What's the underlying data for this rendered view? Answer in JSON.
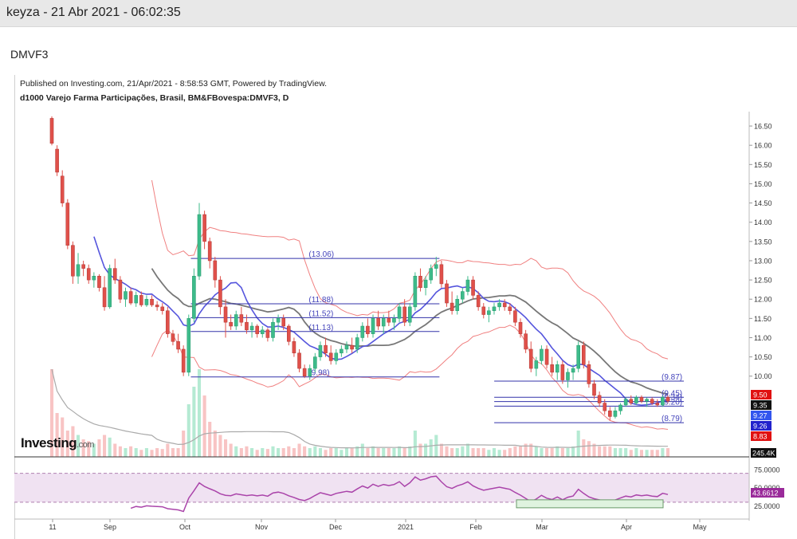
{
  "post": {
    "title": "keyza - 21 Abr 2021 - 06:02:35",
    "subject": "DMVF3"
  },
  "chart_header": {
    "published": "Published on Investing.com, 21/Apr/2021 - 8:58:53 GMT, Powered by TradingView.",
    "instrument": "d1000 Varejo Farma Participações, Brasil, BM&FBovespa:DMVF3, D"
  },
  "logo": {
    "text": "Investing",
    "suffix": ".com"
  },
  "colors": {
    "up": "#3dbb8a",
    "down": "#e0504a",
    "level_line": "#3333aa",
    "ma_fast": "#5555dd",
    "ma_slow": "#777777",
    "band": "#f08080",
    "rsi": "#aa44aa",
    "rsi_fill": "#f0e2f2"
  },
  "chart_data": {
    "type": "candlestick",
    "title": "",
    "x_ticks": [
      "11",
      "Sep",
      "Oct",
      "Nov",
      "Dec",
      "2021",
      "Feb",
      "Mar",
      "Apr",
      "May"
    ],
    "price_axis": {
      "ylim": [
        9.0,
        16.75
      ],
      "ticks": [
        "16.50",
        "16.00",
        "15.50",
        "15.00",
        "14.50",
        "14.00",
        "13.50",
        "13.00",
        "12.50",
        "12.00",
        "11.50",
        "11.00",
        "10.50",
        "10.00"
      ]
    },
    "price_levels": [
      {
        "label": "(13.06)",
        "value": 13.06
      },
      {
        "label": "(11.88)",
        "value": 11.88
      },
      {
        "label": "(11.52)",
        "value": 11.52
      },
      {
        "label": "(11.13)",
        "value": 11.16
      },
      {
        "label": "(9.98)",
        "value": 9.98
      },
      {
        "label": "(9.87)",
        "value": 9.87
      },
      {
        "label": "(9.45)",
        "value": 9.45
      },
      {
        "label": "(9.34)",
        "value": 9.34
      },
      {
        "label": "(9.20)",
        "value": 9.22
      },
      {
        "label": "(8.79)",
        "value": 8.79
      }
    ],
    "price_badges": [
      {
        "label": "9.50",
        "value": 9.5,
        "color": "#e01010"
      },
      {
        "label": "9.35",
        "value": 9.35,
        "color": "#111111"
      },
      {
        "label": "9.27",
        "value": 9.27,
        "color": "#3355ee"
      },
      {
        "label": "9.26",
        "value": 9.26,
        "color": "#2222cc"
      },
      {
        "label": "8.83",
        "value": 8.83,
        "color": "#e01010"
      }
    ],
    "volume_badge": {
      "label": "245.4K"
    },
    "rsi": {
      "ticks": [
        "75.0000",
        "50.0000",
        "25.0000"
      ],
      "current_label": "43.6612",
      "ylim": [
        10,
        85
      ]
    },
    "candles": [
      {
        "o": 16.7,
        "h": 16.75,
        "l": 16.0,
        "c": 16.05
      },
      {
        "o": 15.9,
        "h": 16.0,
        "l": 15.2,
        "c": 15.3
      },
      {
        "o": 15.2,
        "h": 15.35,
        "l": 14.4,
        "c": 14.5
      },
      {
        "o": 14.5,
        "h": 14.6,
        "l": 13.3,
        "c": 13.4
      },
      {
        "o": 13.4,
        "h": 13.5,
        "l": 12.4,
        "c": 12.6
      },
      {
        "o": 12.6,
        "h": 13.2,
        "l": 12.4,
        "c": 12.9
      },
      {
        "o": 12.9,
        "h": 13.0,
        "l": 12.6,
        "c": 12.8
      },
      {
        "o": 12.8,
        "h": 12.9,
        "l": 12.4,
        "c": 12.5
      },
      {
        "o": 12.5,
        "h": 12.7,
        "l": 12.3,
        "c": 12.6
      },
      {
        "o": 12.6,
        "h": 12.65,
        "l": 12.2,
        "c": 12.3
      },
      {
        "o": 12.3,
        "h": 12.6,
        "l": 11.7,
        "c": 11.8
      },
      {
        "o": 11.8,
        "h": 12.9,
        "l": 11.75,
        "c": 12.8
      },
      {
        "o": 12.8,
        "h": 13.05,
        "l": 12.4,
        "c": 12.5
      },
      {
        "o": 12.5,
        "h": 12.6,
        "l": 11.9,
        "c": 12.0
      },
      {
        "o": 12.0,
        "h": 12.3,
        "l": 11.8,
        "c": 12.2
      },
      {
        "o": 12.2,
        "h": 12.3,
        "l": 11.85,
        "c": 11.9
      },
      {
        "o": 11.9,
        "h": 12.2,
        "l": 11.8,
        "c": 12.1
      },
      {
        "o": 12.1,
        "h": 12.2,
        "l": 11.8,
        "c": 11.85
      },
      {
        "o": 11.85,
        "h": 12.1,
        "l": 11.8,
        "c": 12.0
      },
      {
        "o": 12.0,
        "h": 12.1,
        "l": 11.8,
        "c": 11.85
      },
      {
        "o": 11.85,
        "h": 11.95,
        "l": 11.7,
        "c": 11.8
      },
      {
        "o": 11.8,
        "h": 11.9,
        "l": 11.6,
        "c": 11.7
      },
      {
        "o": 11.7,
        "h": 11.8,
        "l": 11.0,
        "c": 11.1
      },
      {
        "o": 11.1,
        "h": 11.2,
        "l": 10.8,
        "c": 10.9
      },
      {
        "o": 10.9,
        "h": 11.1,
        "l": 10.6,
        "c": 10.7
      },
      {
        "o": 10.7,
        "h": 10.8,
        "l": 10.0,
        "c": 10.1
      },
      {
        "o": 10.1,
        "h": 11.6,
        "l": 10.0,
        "c": 11.5
      },
      {
        "o": 11.5,
        "h": 12.8,
        "l": 11.4,
        "c": 12.6
      },
      {
        "o": 12.6,
        "h": 14.5,
        "l": 12.5,
        "c": 14.2
      },
      {
        "o": 14.2,
        "h": 14.3,
        "l": 13.3,
        "c": 13.5
      },
      {
        "o": 13.5,
        "h": 13.6,
        "l": 12.8,
        "c": 13.0
      },
      {
        "o": 13.0,
        "h": 13.1,
        "l": 12.3,
        "c": 12.5
      },
      {
        "o": 12.5,
        "h": 12.6,
        "l": 11.6,
        "c": 11.8
      },
      {
        "o": 11.8,
        "h": 12.0,
        "l": 11.0,
        "c": 11.4
      },
      {
        "o": 11.4,
        "h": 11.6,
        "l": 11.2,
        "c": 11.3
      },
      {
        "o": 11.3,
        "h": 11.7,
        "l": 11.2,
        "c": 11.6
      },
      {
        "o": 11.6,
        "h": 11.8,
        "l": 11.3,
        "c": 11.4
      },
      {
        "o": 11.4,
        "h": 11.6,
        "l": 11.1,
        "c": 11.2
      },
      {
        "o": 11.2,
        "h": 11.4,
        "l": 11.0,
        "c": 11.3
      },
      {
        "o": 11.3,
        "h": 11.35,
        "l": 11.0,
        "c": 11.1
      },
      {
        "o": 11.1,
        "h": 11.3,
        "l": 11.0,
        "c": 11.2
      },
      {
        "o": 11.2,
        "h": 11.25,
        "l": 10.9,
        "c": 11.0
      },
      {
        "o": 11.0,
        "h": 11.5,
        "l": 10.9,
        "c": 11.4
      },
      {
        "o": 11.4,
        "h": 11.6,
        "l": 11.2,
        "c": 11.5
      },
      {
        "o": 11.5,
        "h": 11.6,
        "l": 11.2,
        "c": 11.3
      },
      {
        "o": 11.3,
        "h": 11.35,
        "l": 10.8,
        "c": 10.9
      },
      {
        "o": 10.9,
        "h": 11.0,
        "l": 10.5,
        "c": 10.6
      },
      {
        "o": 10.6,
        "h": 10.7,
        "l": 10.1,
        "c": 10.2
      },
      {
        "o": 10.2,
        "h": 10.3,
        "l": 9.95,
        "c": 10.0
      },
      {
        "o": 10.0,
        "h": 10.3,
        "l": 9.9,
        "c": 10.2
      },
      {
        "o": 10.2,
        "h": 10.6,
        "l": 10.1,
        "c": 10.5
      },
      {
        "o": 10.5,
        "h": 10.9,
        "l": 10.4,
        "c": 10.8
      },
      {
        "o": 10.8,
        "h": 11.0,
        "l": 10.5,
        "c": 10.6
      },
      {
        "o": 10.6,
        "h": 10.8,
        "l": 10.3,
        "c": 10.4
      },
      {
        "o": 10.4,
        "h": 10.7,
        "l": 10.3,
        "c": 10.6
      },
      {
        "o": 10.6,
        "h": 10.8,
        "l": 10.5,
        "c": 10.7
      },
      {
        "o": 10.7,
        "h": 10.9,
        "l": 10.6,
        "c": 10.8
      },
      {
        "o": 10.8,
        "h": 11.0,
        "l": 10.6,
        "c": 10.7
      },
      {
        "o": 10.7,
        "h": 11.1,
        "l": 10.6,
        "c": 11.0
      },
      {
        "o": 11.0,
        "h": 11.4,
        "l": 10.9,
        "c": 11.3
      },
      {
        "o": 11.3,
        "h": 11.5,
        "l": 11.0,
        "c": 11.1
      },
      {
        "o": 11.1,
        "h": 11.6,
        "l": 11.0,
        "c": 11.5
      },
      {
        "o": 11.5,
        "h": 11.7,
        "l": 11.2,
        "c": 11.3
      },
      {
        "o": 11.3,
        "h": 11.6,
        "l": 11.1,
        "c": 11.5
      },
      {
        "o": 11.5,
        "h": 11.7,
        "l": 11.3,
        "c": 11.4
      },
      {
        "o": 11.4,
        "h": 11.6,
        "l": 11.2,
        "c": 11.5
      },
      {
        "o": 11.5,
        "h": 11.9,
        "l": 11.4,
        "c": 11.8
      },
      {
        "o": 11.8,
        "h": 12.0,
        "l": 11.3,
        "c": 11.4
      },
      {
        "o": 11.4,
        "h": 11.9,
        "l": 11.3,
        "c": 11.8
      },
      {
        "o": 11.8,
        "h": 12.7,
        "l": 11.7,
        "c": 12.6
      },
      {
        "o": 12.6,
        "h": 12.8,
        "l": 12.2,
        "c": 12.3
      },
      {
        "o": 12.3,
        "h": 12.6,
        "l": 12.1,
        "c": 12.5
      },
      {
        "o": 12.5,
        "h": 12.9,
        "l": 12.4,
        "c": 12.8
      },
      {
        "o": 12.8,
        "h": 13.1,
        "l": 12.6,
        "c": 12.9
      },
      {
        "o": 12.9,
        "h": 13.0,
        "l": 12.3,
        "c": 12.4
      },
      {
        "o": 12.4,
        "h": 12.5,
        "l": 11.8,
        "c": 11.9
      },
      {
        "o": 11.9,
        "h": 12.2,
        "l": 11.6,
        "c": 11.7
      },
      {
        "o": 11.7,
        "h": 12.1,
        "l": 11.6,
        "c": 12.0
      },
      {
        "o": 12.0,
        "h": 12.3,
        "l": 11.9,
        "c": 12.2
      },
      {
        "o": 12.2,
        "h": 12.6,
        "l": 12.1,
        "c": 12.5
      },
      {
        "o": 12.5,
        "h": 12.6,
        "l": 12.0,
        "c": 12.1
      },
      {
        "o": 12.1,
        "h": 12.2,
        "l": 11.7,
        "c": 11.8
      },
      {
        "o": 11.8,
        "h": 11.9,
        "l": 11.5,
        "c": 11.6
      },
      {
        "o": 11.6,
        "h": 11.8,
        "l": 11.4,
        "c": 11.7
      },
      {
        "o": 11.7,
        "h": 11.9,
        "l": 11.6,
        "c": 11.8
      },
      {
        "o": 11.8,
        "h": 12.0,
        "l": 11.7,
        "c": 11.9
      },
      {
        "o": 11.9,
        "h": 12.0,
        "l": 11.7,
        "c": 11.8
      },
      {
        "o": 11.8,
        "h": 11.9,
        "l": 11.6,
        "c": 11.7
      },
      {
        "o": 11.7,
        "h": 11.8,
        "l": 11.3,
        "c": 11.4
      },
      {
        "o": 11.4,
        "h": 11.5,
        "l": 11.0,
        "c": 11.1
      },
      {
        "o": 11.1,
        "h": 11.2,
        "l": 10.6,
        "c": 10.7
      },
      {
        "o": 10.7,
        "h": 10.9,
        "l": 10.1,
        "c": 10.2
      },
      {
        "o": 10.2,
        "h": 10.5,
        "l": 10.0,
        "c": 10.4
      },
      {
        "o": 10.4,
        "h": 10.8,
        "l": 10.3,
        "c": 10.7
      },
      {
        "o": 10.7,
        "h": 10.8,
        "l": 10.2,
        "c": 10.3
      },
      {
        "o": 10.3,
        "h": 10.5,
        "l": 10.0,
        "c": 10.1
      },
      {
        "o": 10.1,
        "h": 10.4,
        "l": 9.9,
        "c": 10.3
      },
      {
        "o": 10.3,
        "h": 10.4,
        "l": 9.8,
        "c": 9.9
      },
      {
        "o": 9.9,
        "h": 10.2,
        "l": 9.7,
        "c": 10.1
      },
      {
        "o": 10.1,
        "h": 10.3,
        "l": 9.9,
        "c": 10.2
      },
      {
        "o": 10.2,
        "h": 10.9,
        "l": 10.1,
        "c": 10.8
      },
      {
        "o": 10.8,
        "h": 10.9,
        "l": 10.2,
        "c": 10.3
      },
      {
        "o": 10.3,
        "h": 10.4,
        "l": 9.7,
        "c": 9.8
      },
      {
        "o": 9.8,
        "h": 9.9,
        "l": 9.4,
        "c": 9.5
      },
      {
        "o": 9.5,
        "h": 9.6,
        "l": 9.2,
        "c": 9.3
      },
      {
        "o": 9.3,
        "h": 9.4,
        "l": 9.0,
        "c": 9.1
      },
      {
        "o": 9.1,
        "h": 9.2,
        "l": 8.85,
        "c": 8.95
      },
      {
        "o": 8.95,
        "h": 9.2,
        "l": 8.9,
        "c": 9.1
      },
      {
        "o": 9.1,
        "h": 9.3,
        "l": 9.0,
        "c": 9.25
      },
      {
        "o": 9.25,
        "h": 9.45,
        "l": 9.2,
        "c": 9.4
      },
      {
        "o": 9.4,
        "h": 9.5,
        "l": 9.25,
        "c": 9.3
      },
      {
        "o": 9.3,
        "h": 9.5,
        "l": 9.25,
        "c": 9.45
      },
      {
        "o": 9.45,
        "h": 9.5,
        "l": 9.3,
        "c": 9.35
      },
      {
        "o": 9.35,
        "h": 9.45,
        "l": 9.2,
        "c": 9.4
      },
      {
        "o": 9.4,
        "h": 9.45,
        "l": 9.25,
        "c": 9.3
      },
      {
        "o": 9.3,
        "h": 9.4,
        "l": 9.2,
        "c": 9.25
      },
      {
        "o": 9.25,
        "h": 9.5,
        "l": 9.2,
        "c": 9.45
      },
      {
        "o": 9.45,
        "h": 9.5,
        "l": 9.3,
        "c": 9.35
      }
    ],
    "volume": [
      1.0,
      0.5,
      0.45,
      0.3,
      0.35,
      0.25,
      0.2,
      0.18,
      0.15,
      0.2,
      0.25,
      0.22,
      0.15,
      0.12,
      0.1,
      0.12,
      0.1,
      0.08,
      0.1,
      0.08,
      0.1,
      0.09,
      0.15,
      0.1,
      0.1,
      0.3,
      0.6,
      0.8,
      1.0,
      0.7,
      0.4,
      0.3,
      0.25,
      0.2,
      0.15,
      0.12,
      0.1,
      0.12,
      0.1,
      0.08,
      0.1,
      0.09,
      0.12,
      0.1,
      0.1,
      0.12,
      0.1,
      0.15,
      0.12,
      0.1,
      0.12,
      0.1,
      0.08,
      0.1,
      0.1,
      0.08,
      0.1,
      0.1,
      0.12,
      0.15,
      0.1,
      0.12,
      0.1,
      0.1,
      0.1,
      0.1,
      0.12,
      0.1,
      0.12,
      0.3,
      0.15,
      0.15,
      0.2,
      0.25,
      0.15,
      0.12,
      0.1,
      0.1,
      0.12,
      0.15,
      0.1,
      0.1,
      0.1,
      0.08,
      0.1,
      0.08,
      0.08,
      0.1,
      0.12,
      0.12,
      0.15,
      0.15,
      0.12,
      0.1,
      0.1,
      0.1,
      0.12,
      0.1,
      0.1,
      0.12,
      0.3,
      0.2,
      0.18,
      0.15,
      0.12,
      0.12,
      0.12,
      0.1,
      0.1,
      0.1,
      0.08,
      0.1,
      0.08,
      0.08,
      0.08,
      0.08,
      0.1,
      0.1
    ]
  }
}
